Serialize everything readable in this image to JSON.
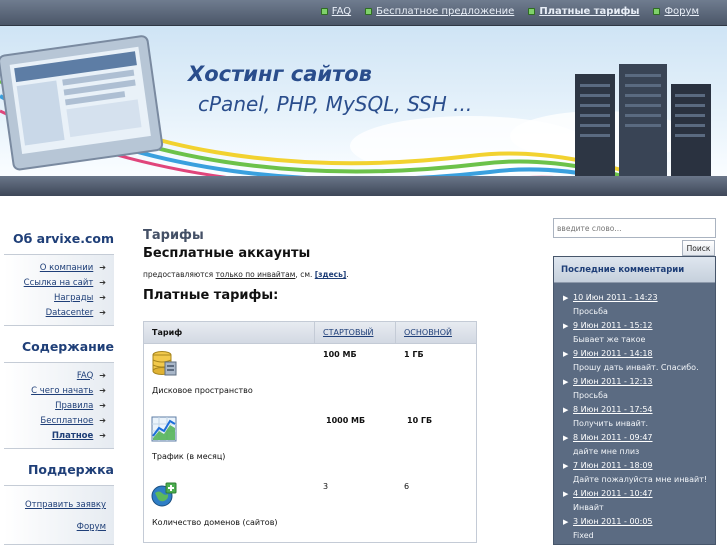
{
  "topnav": {
    "items": [
      {
        "label": "FAQ"
      },
      {
        "label": "Бесплатное предложение"
      },
      {
        "label": "Платные тарифы"
      },
      {
        "label": "Форум"
      }
    ]
  },
  "banner": {
    "title": "Хостинг сайтов",
    "subtitle": "cPanel, PHP, MySQL, SSH ..."
  },
  "sidebar": {
    "about_heading": "Об arvixe.com",
    "about_items": [
      {
        "label": "О компании"
      },
      {
        "label": "Ссылка на сайт"
      },
      {
        "label": "Награды"
      },
      {
        "label": "Datacenter"
      }
    ],
    "content_heading": "Содержание",
    "content_items": [
      {
        "label": "FAQ"
      },
      {
        "label": "С чего начать"
      },
      {
        "label": "Правила"
      },
      {
        "label": "Бесплатное"
      },
      {
        "label": "Платное"
      }
    ],
    "support_heading": "Поддержка",
    "support_items": [
      {
        "label": "Отправить заявку"
      },
      {
        "label": "Форум"
      }
    ]
  },
  "main": {
    "page_title": "Тарифы",
    "free_heading": "Бесплатные аккаунты",
    "free_text_prefix": "предоставляются ",
    "free_text_link": "только по инвайтам",
    "free_text_middle": ", см. ",
    "free_text_here": "[здесь]",
    "free_text_suffix": ".",
    "paid_heading": "Платные тарифы:",
    "table": {
      "headers": [
        "Тариф",
        "СТАРТОВЫЙ",
        "ОСНОВНОЙ"
      ],
      "rows": [
        {
          "label": "Дисковое пространство",
          "starter": "100 МБ",
          "basic": "1 ГБ",
          "icon": "database-icon"
        },
        {
          "label": "Трафик (в месяц)",
          "starter": "1000 МБ",
          "basic": "10 ГБ",
          "icon": "chart-icon"
        },
        {
          "label": "Количество доменов (сайтов)",
          "starter": "3",
          "basic": "6",
          "icon": "globe-add-icon"
        }
      ]
    }
  },
  "search": {
    "placeholder": "введите слово...",
    "button_label": "Поиск"
  },
  "comments": {
    "title": "Последние комментарии",
    "items": [
      {
        "date": "10 Июн 2011 - 14:23",
        "text": "Просьба"
      },
      {
        "date": "9 Июн 2011 - 15:12",
        "text": "Бывает же такое"
      },
      {
        "date": "9 Июн 2011 - 14:18",
        "text": "Прошу дать инвайт. Спасибо."
      },
      {
        "date": "9 Июн 2011 - 12:13",
        "text": "Просьба"
      },
      {
        "date": "8 Июн 2011 - 17:54",
        "text": "Получить инвайт."
      },
      {
        "date": "8 Июн 2011 - 09:47",
        "text": "дайте мне плиз"
      },
      {
        "date": "7 Июн 2011 - 18:09",
        "text": "Дайте пожалуйста мне инвайт!"
      },
      {
        "date": "4 Июн 2011 - 10:47",
        "text": "Инвайт"
      },
      {
        "date": "3 Июн 2011 - 00:05",
        "text": "Fixed"
      }
    ]
  }
}
